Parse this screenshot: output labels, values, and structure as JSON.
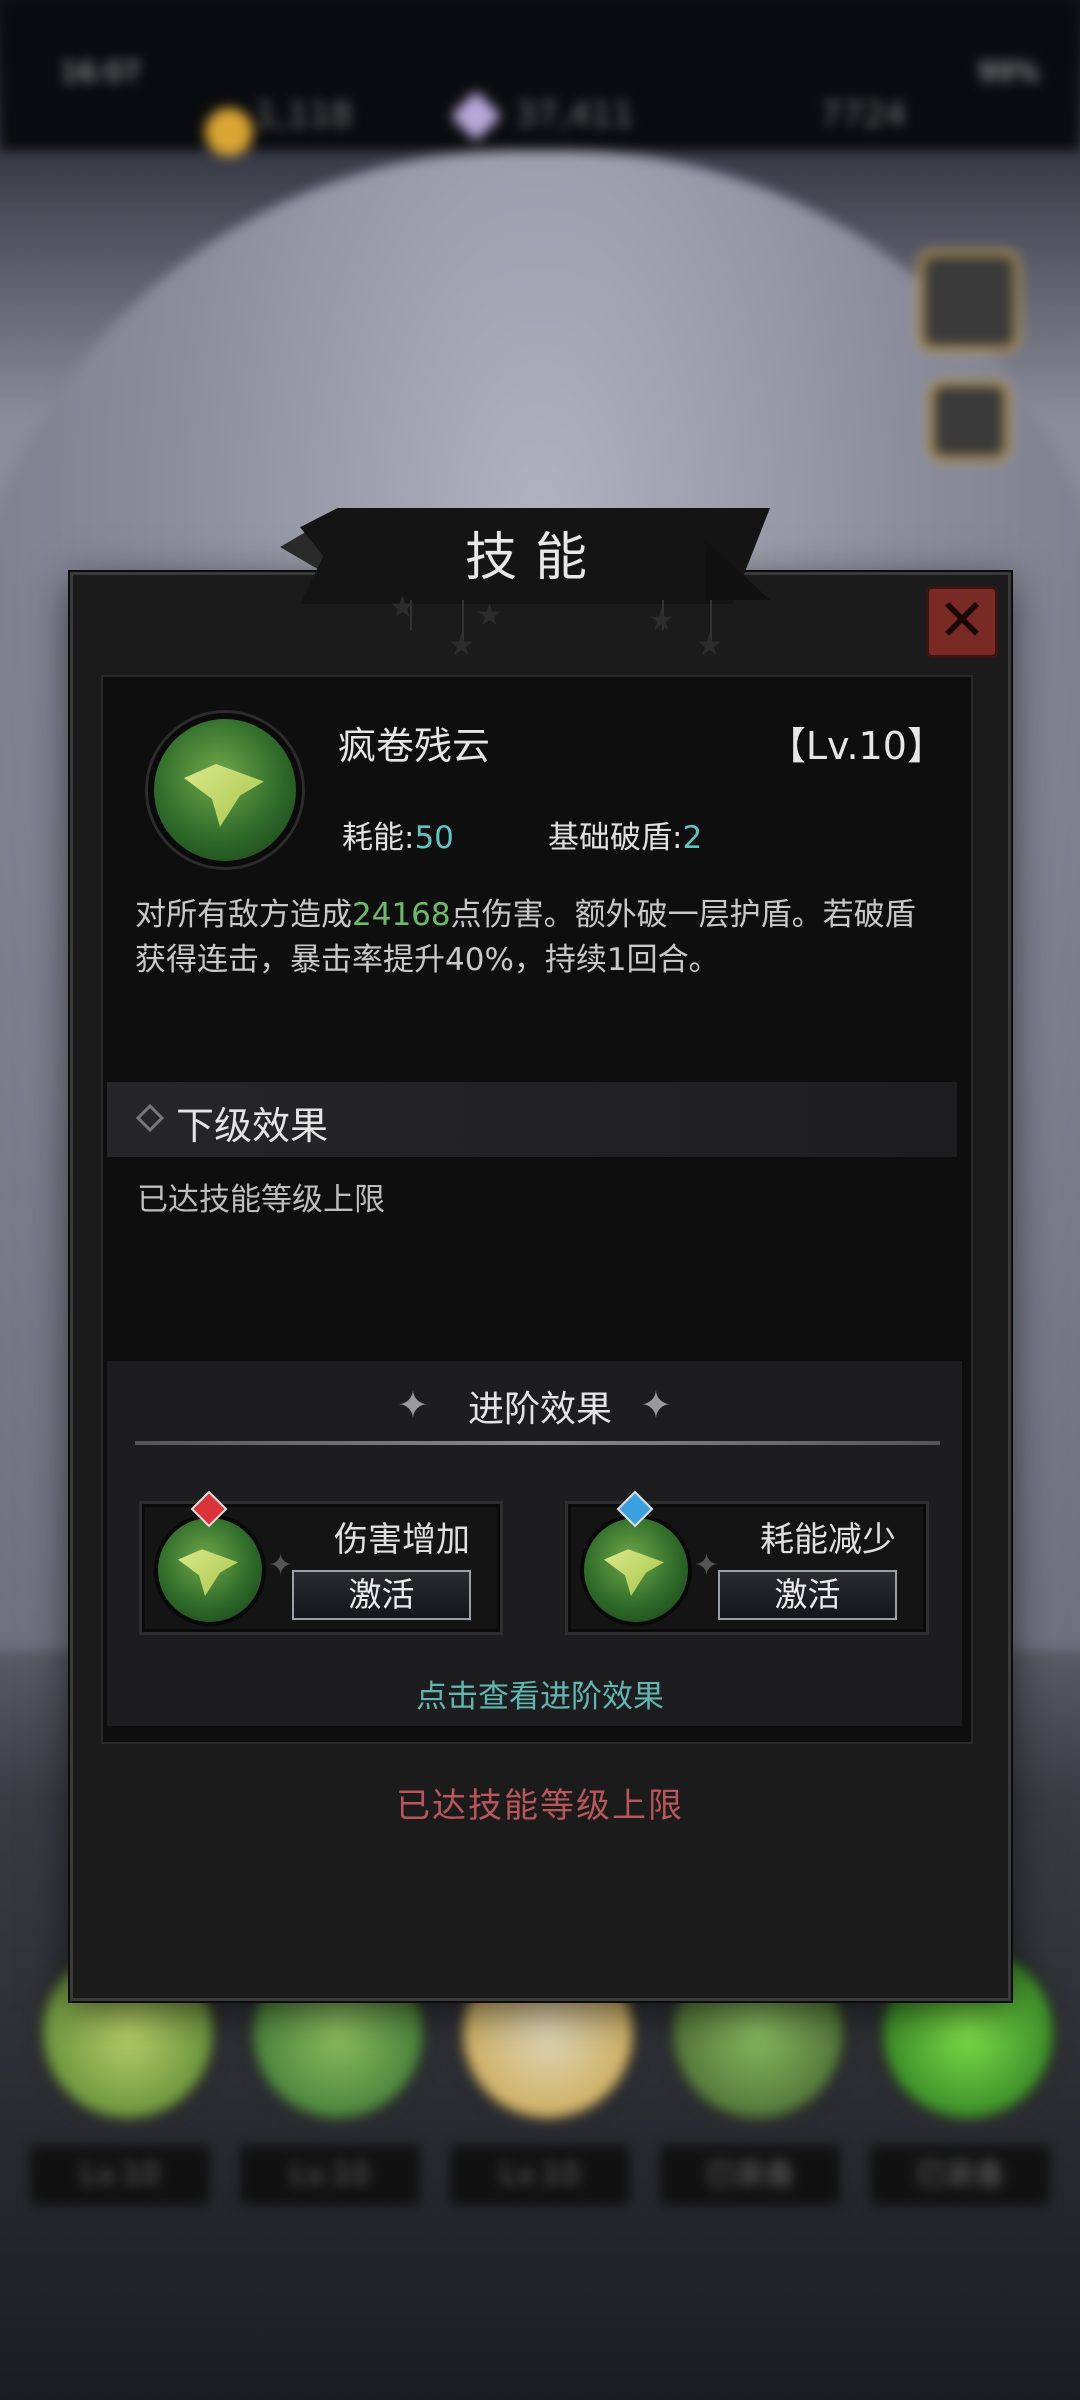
{
  "status": {
    "time": "16:07",
    "battery": "99%"
  },
  "resources": {
    "gold": "1,118",
    "gems": "37,411",
    "energy": "7724"
  },
  "dialog": {
    "title": "技能",
    "skill": {
      "name": "疯卷残云",
      "level": "【Lv.10】",
      "cost_label": "耗能:",
      "cost_value": "50",
      "break_label": "基础破盾:",
      "break_value": "2",
      "desc_prefix": "对所有敌方造成",
      "desc_damage": "24168",
      "desc_suffix": "点伤害。额外破一层护盾。若破盾获得连击，暴击率提升40%，持续1回合。"
    },
    "next_level": {
      "title": "下级效果",
      "note": "已达技能等级上限"
    },
    "advanced": {
      "title": "进阶效果",
      "cards": [
        {
          "label": "伤害增加",
          "button": "激活",
          "gem_color": "#d9343a"
        },
        {
          "label": "耗能减少",
          "button": "激活",
          "gem_color": "#3aa0e0"
        }
      ],
      "view_link": "点击查看进阶效果"
    },
    "bottom_note": "已达技能等级上限"
  },
  "background": {
    "levels": [
      "Lv.10",
      "Lv.10",
      "Lv.10",
      "已装备",
      "已装备"
    ]
  },
  "colors": {
    "accent_teal": "#5fc4c2",
    "damage_green": "#6dbb6a",
    "warning_red": "#b8565a",
    "close_red": "#7a2a24"
  }
}
